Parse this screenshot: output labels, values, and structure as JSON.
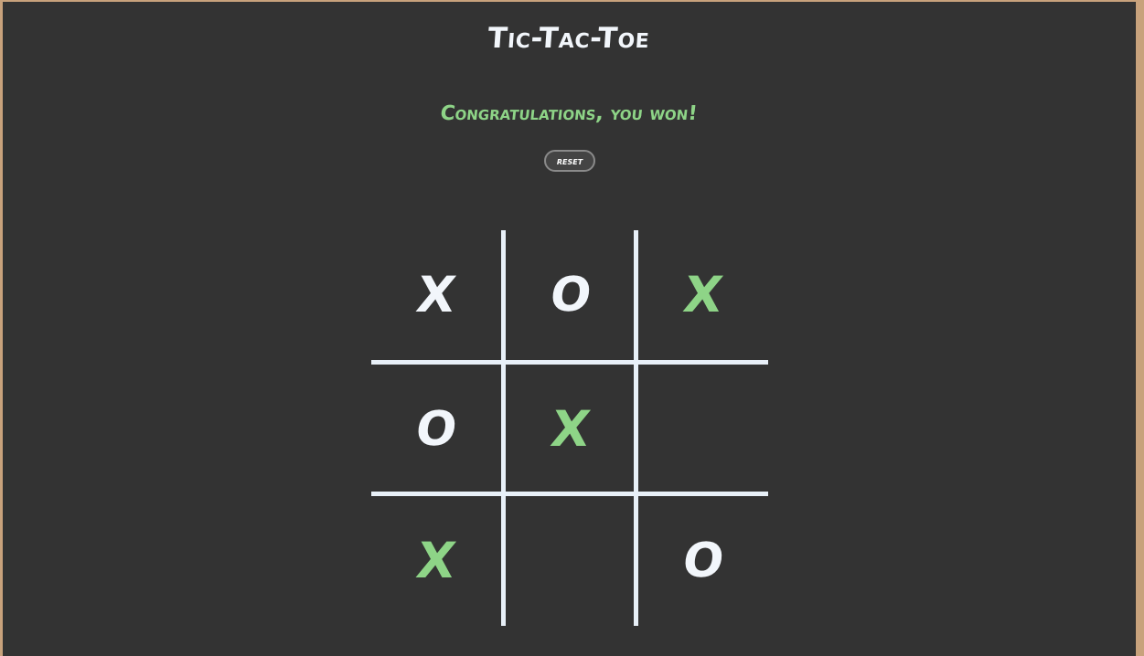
{
  "title": "Tic-Tac-Toe",
  "status": "Congratulations, you won!",
  "reset_label": "reset",
  "colors": {
    "background": "#333333",
    "text": "#f2f6fb",
    "accent": "#8ed487"
  },
  "board": [
    {
      "value": "X",
      "win": false
    },
    {
      "value": "O",
      "win": false
    },
    {
      "value": "X",
      "win": true
    },
    {
      "value": "O",
      "win": false
    },
    {
      "value": "X",
      "win": true
    },
    {
      "value": "",
      "win": false
    },
    {
      "value": "X",
      "win": true
    },
    {
      "value": "",
      "win": false
    },
    {
      "value": "O",
      "win": false
    }
  ]
}
